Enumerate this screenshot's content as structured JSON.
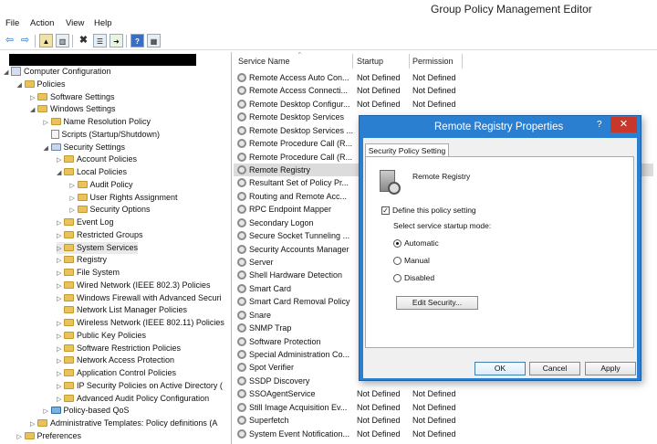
{
  "window": {
    "title": "Group Policy Management Editor"
  },
  "menu": [
    "File",
    "Action",
    "View",
    "Help"
  ],
  "tree": [
    {
      "label": "Computer Configuration",
      "indent": 0,
      "arrow": "◢",
      "icon": "computer"
    },
    {
      "label": "Policies",
      "indent": 1,
      "arrow": "◢",
      "icon": "folder"
    },
    {
      "label": "Software Settings",
      "indent": 2,
      "arrow": "▷",
      "icon": "folder"
    },
    {
      "label": "Windows Settings",
      "indent": 2,
      "arrow": "◢",
      "icon": "folder"
    },
    {
      "label": "Name Resolution Policy",
      "indent": 3,
      "arrow": "▷",
      "icon": "folder"
    },
    {
      "label": "Scripts (Startup/Shutdown)",
      "indent": 3,
      "arrow": "",
      "icon": "doc"
    },
    {
      "label": "Security Settings",
      "indent": 3,
      "arrow": "◢",
      "icon": "shield"
    },
    {
      "label": "Account Policies",
      "indent": 4,
      "arrow": "▷",
      "icon": "folder"
    },
    {
      "label": "Local Policies",
      "indent": 4,
      "arrow": "◢",
      "icon": "folder"
    },
    {
      "label": "Audit Policy",
      "indent": 5,
      "arrow": "▷",
      "icon": "folder"
    },
    {
      "label": "User Rights Assignment",
      "indent": 5,
      "arrow": "▷",
      "icon": "folder"
    },
    {
      "label": "Security Options",
      "indent": 5,
      "arrow": "▷",
      "icon": "folder"
    },
    {
      "label": "Event Log",
      "indent": 4,
      "arrow": "▷",
      "icon": "folder"
    },
    {
      "label": "Restricted Groups",
      "indent": 4,
      "arrow": "▷",
      "icon": "folder"
    },
    {
      "label": "System Services",
      "indent": 4,
      "arrow": "▷",
      "icon": "folder"
    },
    {
      "label": "Registry",
      "indent": 4,
      "arrow": "▷",
      "icon": "folder"
    },
    {
      "label": "File System",
      "indent": 4,
      "arrow": "▷",
      "icon": "folder"
    },
    {
      "label": "Wired Network (IEEE 802.3) Policies",
      "indent": 4,
      "arrow": "▷",
      "icon": "folder"
    },
    {
      "label": "Windows Firewall with Advanced Securi",
      "indent": 4,
      "arrow": "▷",
      "icon": "folder"
    },
    {
      "label": "Network List Manager Policies",
      "indent": 4,
      "arrow": "",
      "icon": "folder"
    },
    {
      "label": "Wireless Network (IEEE 802.11) Policies",
      "indent": 4,
      "arrow": "▷",
      "icon": "folder"
    },
    {
      "label": "Public Key Policies",
      "indent": 4,
      "arrow": "▷",
      "icon": "folder"
    },
    {
      "label": "Software Restriction Policies",
      "indent": 4,
      "arrow": "▷",
      "icon": "folder"
    },
    {
      "label": "Network Access Protection",
      "indent": 4,
      "arrow": "▷",
      "icon": "folder"
    },
    {
      "label": "Application Control Policies",
      "indent": 4,
      "arrow": "▷",
      "icon": "folder"
    },
    {
      "label": "IP Security Policies on Active Directory (",
      "indent": 4,
      "arrow": "▷",
      "icon": "folder"
    },
    {
      "label": "Advanced Audit Policy Configuration",
      "indent": 4,
      "arrow": "▷",
      "icon": "folder"
    },
    {
      "label": "Policy-based QoS",
      "indent": 3,
      "arrow": "▷",
      "icon": "chart"
    },
    {
      "label": "Administrative Templates: Policy definitions (A",
      "indent": 2,
      "arrow": "▷",
      "icon": "folder"
    },
    {
      "label": "Preferences",
      "indent": 1,
      "arrow": "▷",
      "icon": "folder"
    }
  ],
  "columns": {
    "name": "Service Name",
    "startup": "Startup",
    "permission": "Permission"
  },
  "services": [
    {
      "name": "Remote Access Auto Con...",
      "startup": "Not Defined",
      "permission": "Not Defined"
    },
    {
      "name": "Remote Access Connecti...",
      "startup": "Not Defined",
      "permission": "Not Defined"
    },
    {
      "name": "Remote Desktop Configur...",
      "startup": "Not Defined",
      "permission": "Not Defined"
    },
    {
      "name": "Remote Desktop Services",
      "startup": "",
      "permission": ""
    },
    {
      "name": "Remote Desktop Services ...",
      "startup": "",
      "permission": ""
    },
    {
      "name": "Remote Procedure Call (R...",
      "startup": "",
      "permission": ""
    },
    {
      "name": "Remote Procedure Call (R...",
      "startup": "",
      "permission": ""
    },
    {
      "name": "Remote Registry",
      "startup": "",
      "permission": ""
    },
    {
      "name": "Resultant Set of Policy Pr...",
      "startup": "",
      "permission": ""
    },
    {
      "name": "Routing and Remote Acc...",
      "startup": "",
      "permission": ""
    },
    {
      "name": "RPC Endpoint Mapper",
      "startup": "",
      "permission": ""
    },
    {
      "name": "Secondary Logon",
      "startup": "",
      "permission": ""
    },
    {
      "name": "Secure Socket Tunneling ...",
      "startup": "",
      "permission": ""
    },
    {
      "name": "Security Accounts Manager",
      "startup": "",
      "permission": ""
    },
    {
      "name": "Server",
      "startup": "",
      "permission": ""
    },
    {
      "name": "Shell Hardware Detection",
      "startup": "",
      "permission": ""
    },
    {
      "name": "Smart Card",
      "startup": "",
      "permission": ""
    },
    {
      "name": "Smart Card Removal Policy",
      "startup": "",
      "permission": ""
    },
    {
      "name": "Snare",
      "startup": "",
      "permission": ""
    },
    {
      "name": "SNMP Trap",
      "startup": "",
      "permission": ""
    },
    {
      "name": "Software Protection",
      "startup": "",
      "permission": ""
    },
    {
      "name": "Special Administration Co...",
      "startup": "",
      "permission": ""
    },
    {
      "name": "Spot Verifier",
      "startup": "",
      "permission": ""
    },
    {
      "name": "SSDP Discovery",
      "startup": "",
      "permission": ""
    },
    {
      "name": "SSOAgentService",
      "startup": "Not Defined",
      "permission": "Not Defined"
    },
    {
      "name": "Still Image Acquisition Ev...",
      "startup": "Not Defined",
      "permission": "Not Defined"
    },
    {
      "name": "Superfetch",
      "startup": "Not Defined",
      "permission": "Not Defined"
    },
    {
      "name": "System Event Notification...",
      "startup": "Not Defined",
      "permission": "Not Defined"
    }
  ],
  "dialog": {
    "title": "Remote Registry Properties",
    "help": "?",
    "close": "✕",
    "tab": "Security Policy Setting",
    "service_name": "Remote Registry",
    "define_label": "Define this policy setting",
    "define_checked": "✓",
    "mode_label": "Select service startup mode:",
    "modes": [
      "Automatic",
      "Manual",
      "Disabled"
    ],
    "edit_security": "Edit Security...",
    "ok": "OK",
    "cancel": "Cancel",
    "apply": "Apply"
  },
  "colors": {
    "dialog_frame": "#2b7fd0",
    "close_button": "#c7382b",
    "folder": "#e8c25a"
  }
}
